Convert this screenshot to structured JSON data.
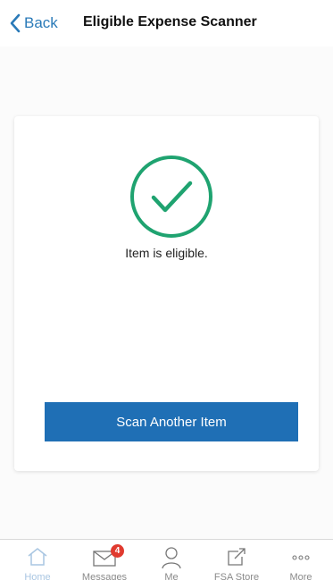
{
  "nav": {
    "back_label": "Back",
    "title": "Eligible Expense Scanner"
  },
  "result": {
    "status_text": "Item is eligible.",
    "icon": "check-circle-icon",
    "icon_color": "#1fa370"
  },
  "actions": {
    "scan_another_label": "Scan Another Item",
    "button_color": "#1f6fb5"
  },
  "tabbar": {
    "tabs": [
      {
        "label": "Home",
        "icon": "home-icon",
        "active": true
      },
      {
        "label": "Messages",
        "icon": "envelope-icon",
        "badge": "4"
      },
      {
        "label": "Me",
        "icon": "person-icon"
      },
      {
        "label": "FSA Store",
        "icon": "external-link-icon"
      },
      {
        "label": "More",
        "icon": "more-dots-icon"
      }
    ]
  }
}
